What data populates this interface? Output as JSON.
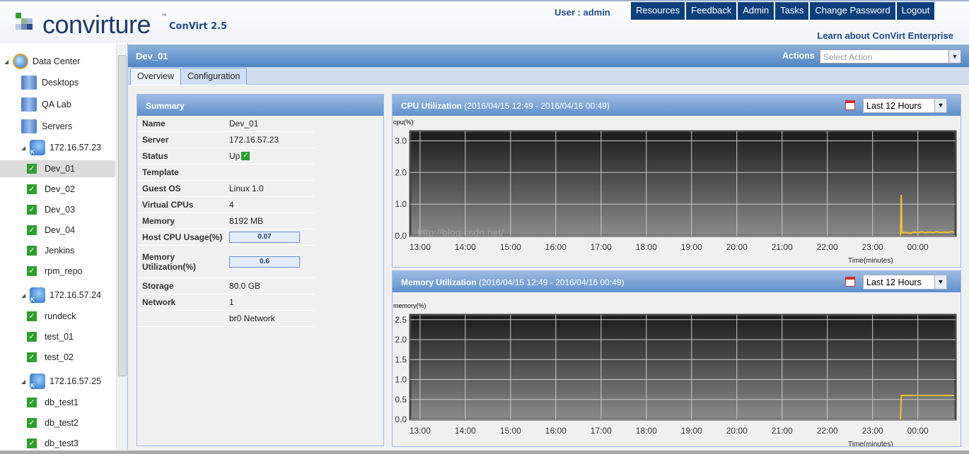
{
  "header": {
    "logo_text": "convirture",
    "trademark": "™",
    "version": "ConVirt 2.5",
    "user": "User : admin",
    "nav": [
      "Resources",
      "Feedback",
      "Admin",
      "Tasks",
      "Change Password",
      "Logout"
    ],
    "learn_link": "Learn about ConVirt Enterprise"
  },
  "tree": [
    {
      "label": "Data Center",
      "type": "datacenter",
      "level": 0
    },
    {
      "label": "Desktops",
      "type": "group",
      "level": 1
    },
    {
      "label": "QA Lab",
      "type": "group",
      "level": 1
    },
    {
      "label": "Servers",
      "type": "group",
      "level": 1
    },
    {
      "label": "172.16.57.23",
      "type": "server",
      "level": 2
    },
    {
      "label": "Dev_01",
      "type": "vm",
      "level": 3,
      "selected": true
    },
    {
      "label": "Dev_02",
      "type": "vm",
      "level": 3
    },
    {
      "label": "Dev_03",
      "type": "vm",
      "level": 3
    },
    {
      "label": "Dev_04",
      "type": "vm",
      "level": 3
    },
    {
      "label": "Jenkins",
      "type": "vm",
      "level": 3
    },
    {
      "label": "rpm_repo",
      "type": "vm",
      "level": 3
    },
    {
      "label": "172.16.57.24",
      "type": "server",
      "level": 2
    },
    {
      "label": "rundeck",
      "type": "vm",
      "level": 3
    },
    {
      "label": "test_01",
      "type": "vm",
      "level": 3
    },
    {
      "label": "test_02",
      "type": "vm",
      "level": 3
    },
    {
      "label": "172.16.57.25",
      "type": "server",
      "level": 2
    },
    {
      "label": "db_test1",
      "type": "vm",
      "level": 3
    },
    {
      "label": "db_test2",
      "type": "vm",
      "level": 3
    },
    {
      "label": "db_test3",
      "type": "vm",
      "level": 3
    }
  ],
  "main": {
    "title": "Dev_01",
    "actions_label": "Actions",
    "actions_placeholder": "Select Action",
    "tabs": [
      "Overview",
      "Configuration"
    ],
    "active_tab": "Overview"
  },
  "summary": {
    "title": "Summary",
    "rows": [
      {
        "k": "Name",
        "v": "Dev_01"
      },
      {
        "k": "Server",
        "v": "172.16.57.23"
      },
      {
        "k": "Status",
        "v": "Up",
        "check": true
      },
      {
        "k": "Template",
        "v": ""
      },
      {
        "k": "Guest OS",
        "v": "Linux 1.0"
      },
      {
        "k": "Virtual CPUs",
        "v": "4"
      },
      {
        "k": "Memory",
        "v": "8192 MB"
      },
      {
        "k": "Host CPU Usage(%)",
        "v": "0.07",
        "bar": true
      },
      {
        "k": "Memory Utilization(%)",
        "v": "0.6",
        "bar": true
      },
      {
        "k": "Storage",
        "v": "80.0 GB"
      },
      {
        "k": "Network",
        "v": "1"
      },
      {
        "k": "",
        "v": "br0 Network"
      }
    ]
  },
  "watermark": "http://blog.csdn.net/",
  "chart_data": [
    {
      "type": "line",
      "title": "CPU Utilization",
      "subtitle": "(2016/04/15 12:49 - 2016/04/16 00:49)",
      "range_select": "Last 12 Hours",
      "ylabel": "cpu(%)",
      "xlabel": "Time(minutes)",
      "ylim": [
        0,
        3.3
      ],
      "yticks": [
        "0.0",
        "1.0",
        "2.0",
        "3.0"
      ],
      "xlim": [
        "12:47",
        "00:50"
      ],
      "xticks": [
        "13:00",
        "14:00",
        "15:00",
        "16:00",
        "17:00",
        "18:00",
        "19:00",
        "20:00",
        "21:00",
        "22:00",
        "23:00",
        "00:00"
      ],
      "grid": true,
      "color": "#f0c030",
      "x": [
        "23:37",
        "23:38",
        "23:39",
        "23:45",
        "23:50",
        "23:55",
        "00:00",
        "00:05",
        "00:10",
        "00:15",
        "00:20",
        "00:25",
        "00:30",
        "00:35",
        "00:40",
        "00:45",
        "00:48"
      ],
      "y": [
        0,
        1.3,
        0.1,
        0.1,
        0.08,
        0.12,
        0.1,
        0.13,
        0.1,
        0.12,
        0.1,
        0.13,
        0.1,
        0.12,
        0.11,
        0.13,
        0.12
      ]
    },
    {
      "type": "line",
      "title": "Memory Utilization",
      "subtitle": "(2016/04/15 12:49 - 2016/04/16 00:49)",
      "range_select": "Last 12 Hours",
      "ylabel": "memory(%)",
      "xlabel": "Time(minutes)",
      "ylim": [
        0,
        2.62
      ],
      "yticks": [
        "0.0",
        "0.5",
        "1.0",
        "1.5",
        "2.0",
        "2.5"
      ],
      "xlim": [
        "12:47",
        "00:50"
      ],
      "xticks": [
        "13:00",
        "14:00",
        "15:00",
        "16:00",
        "17:00",
        "18:00",
        "19:00",
        "20:00",
        "21:00",
        "22:00",
        "23:00",
        "00:00"
      ],
      "grid": true,
      "color": "#f0c030",
      "x": [
        "23:37",
        "23:38",
        "00:48"
      ],
      "y": [
        0,
        0.6,
        0.6
      ]
    }
  ],
  "colors": {
    "nav_bg": "#0e3f7a",
    "header_text": "#1d4a86",
    "panel_header": "#5f90cc",
    "series": "#f0c030"
  }
}
